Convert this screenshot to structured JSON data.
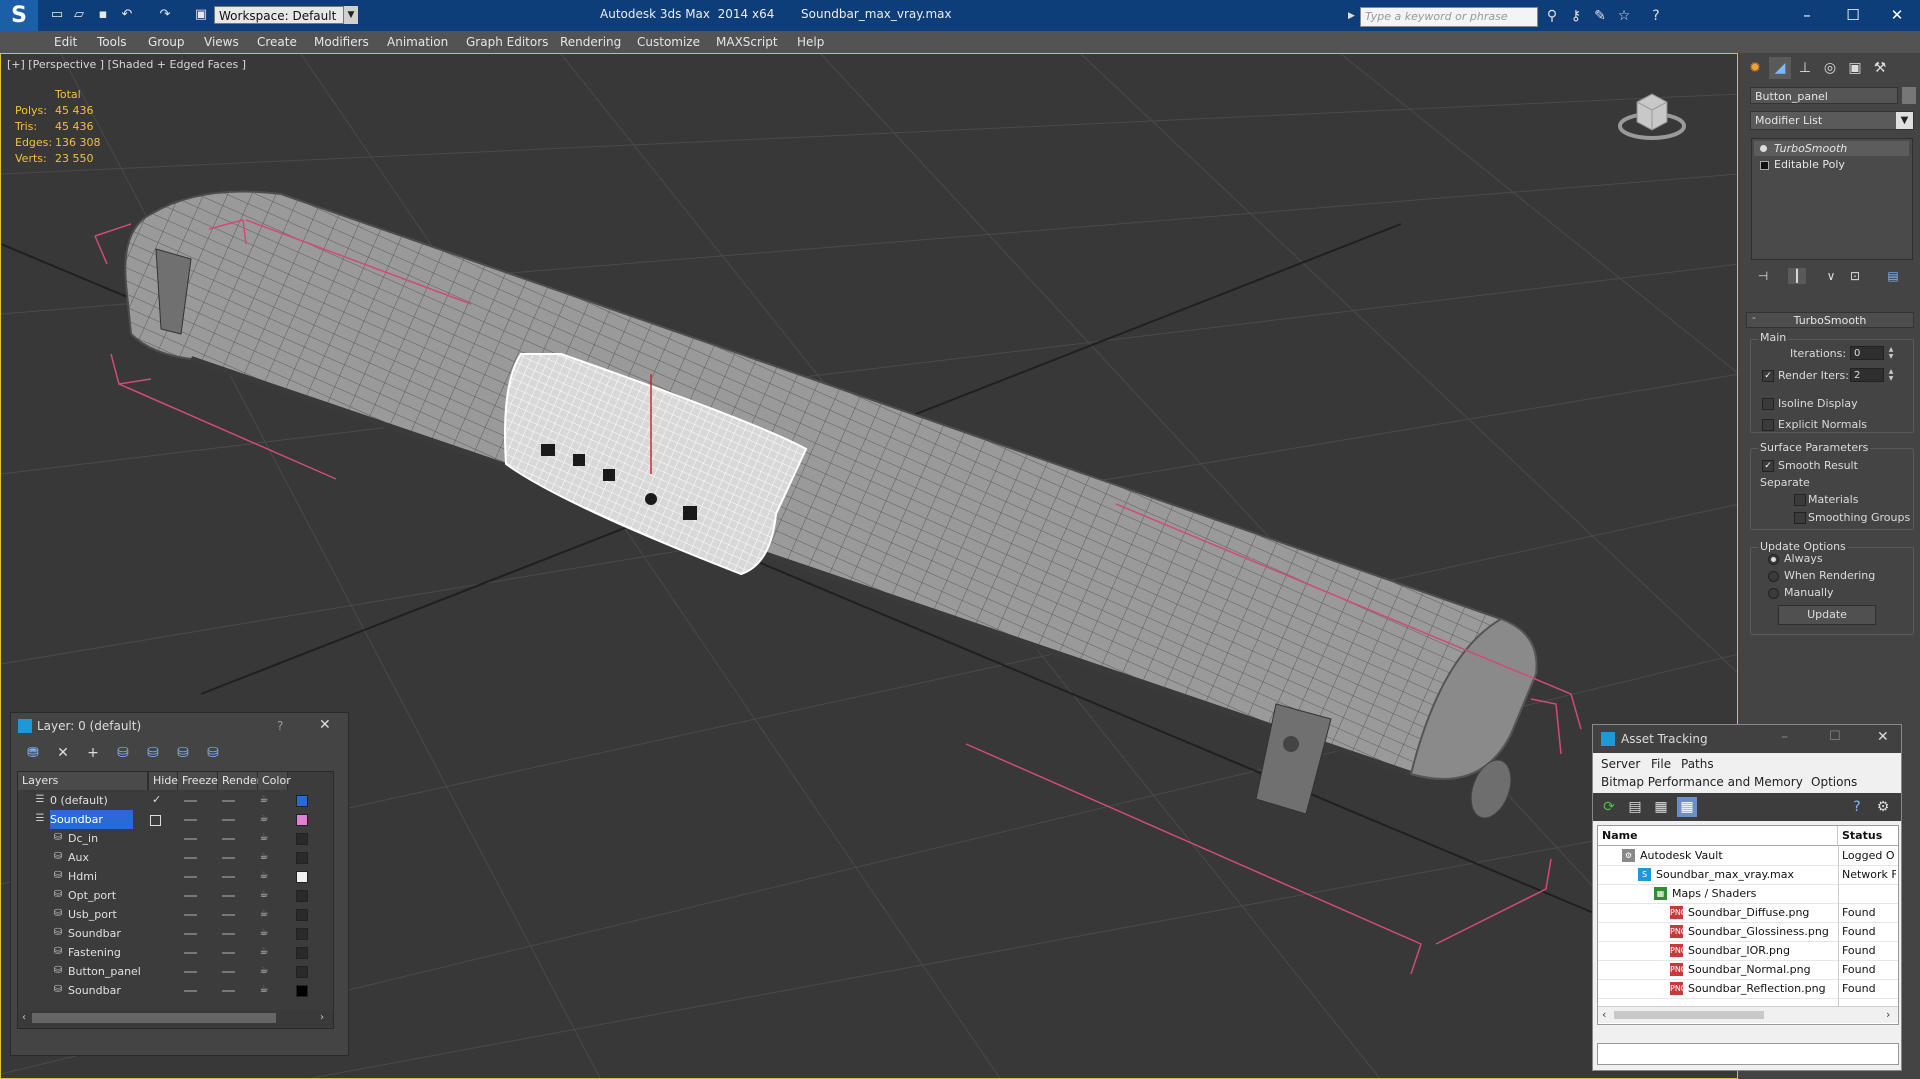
{
  "titlebar": {
    "workspace": "Workspace: Default",
    "title": "Autodesk 3ds Max  2014 x64       Soundbar_max_vray.max",
    "search_placeholder": "Type a keyword or phrase"
  },
  "menu": [
    "Edit",
    "Tools",
    "Group",
    "Views",
    "Create",
    "Modifiers",
    "Animation",
    "Graph Editors",
    "Rendering",
    "Customize",
    "MAXScript",
    "Help"
  ],
  "viewport": {
    "label": "[+] [Perspective ] [Shaded + Edged Faces ]",
    "stats": {
      "header": "Total",
      "rows": [
        {
          "label": "Polys:",
          "value": "45 436"
        },
        {
          "label": "Tris:",
          "value": "45 436"
        },
        {
          "label": "Edges:",
          "value": "136 308"
        },
        {
          "label": "Verts:",
          "value": "23 550"
        }
      ]
    }
  },
  "command_panel": {
    "object_name": "Button_panel",
    "modifier_list": "Modifier List",
    "stack": [
      "TurboSmooth",
      "Editable Poly"
    ],
    "turbosmooth": {
      "title": "TurboSmooth",
      "main_label": "Main",
      "iterations_label": "Iterations:",
      "iterations_value": "0",
      "render_iters_label": "Render Iters:",
      "render_iters_value": "2",
      "isoline_display": "Isoline Display",
      "explicit_normals": "Explicit Normals",
      "surface_params_label": "Surface Parameters",
      "smooth_result": "Smooth Result",
      "separate_label": "Separate",
      "materials": "Materials",
      "smoothing_groups": "Smoothing Groups",
      "update_options_label": "Update Options",
      "always": "Always",
      "when_rendering": "When Rendering",
      "manually": "Manually",
      "update_button": "Update"
    }
  },
  "layer_panel": {
    "title": "Layer: 0 (default)",
    "help": "?",
    "columns": [
      "Layers",
      "Hide",
      "Freeze",
      "Render",
      "Color"
    ],
    "rows": [
      {
        "name": "0 (default)",
        "level": 0,
        "color": "#2a6ad8"
      },
      {
        "name": "Soundbar",
        "level": 0,
        "color": "#e080d0",
        "selected": true
      },
      {
        "name": "Dc_in",
        "level": 1,
        "color": "#2a2a2a"
      },
      {
        "name": "Aux",
        "level": 1,
        "color": "#2a2a2a"
      },
      {
        "name": "Hdmi",
        "level": 1,
        "color": "#f0f0f0"
      },
      {
        "name": "Opt_port",
        "level": 1,
        "color": "#2a2a2a"
      },
      {
        "name": "Usb_port",
        "level": 1,
        "color": "#2a2a2a"
      },
      {
        "name": "Soundbar",
        "level": 1,
        "color": "#2a2a2a"
      },
      {
        "name": "Fastening",
        "level": 1,
        "color": "#2a2a2a"
      },
      {
        "name": "Button_panel",
        "level": 1,
        "color": "#2a2a2a"
      },
      {
        "name": "Soundbar",
        "level": 1,
        "color": "#000000"
      }
    ]
  },
  "asset_tracking": {
    "title": "Asset Tracking",
    "menu_row1": [
      "Server",
      "File",
      "Paths"
    ],
    "menu_row2": [
      "Bitmap Performance and Memory",
      "Options"
    ],
    "columns": [
      "Name",
      "Status"
    ],
    "rows": [
      {
        "name": "Autodesk Vault",
        "status": "Logged O",
        "level": 1
      },
      {
        "name": "Soundbar_max_vray.max",
        "status": "Network F",
        "level": 2
      },
      {
        "name": "Maps / Shaders",
        "status": "",
        "level": 3
      },
      {
        "name": "Soundbar_Diffuse.png",
        "status": "Found",
        "level": 4
      },
      {
        "name": "Soundbar_Glossiness.png",
        "status": "Found",
        "level": 4
      },
      {
        "name": "Soundbar_IOR.png",
        "status": "Found",
        "level": 4
      },
      {
        "name": "Soundbar_Normal.png",
        "status": "Found",
        "level": 4
      },
      {
        "name": "Soundbar_Reflection.png",
        "status": "Found",
        "level": 4
      }
    ]
  }
}
